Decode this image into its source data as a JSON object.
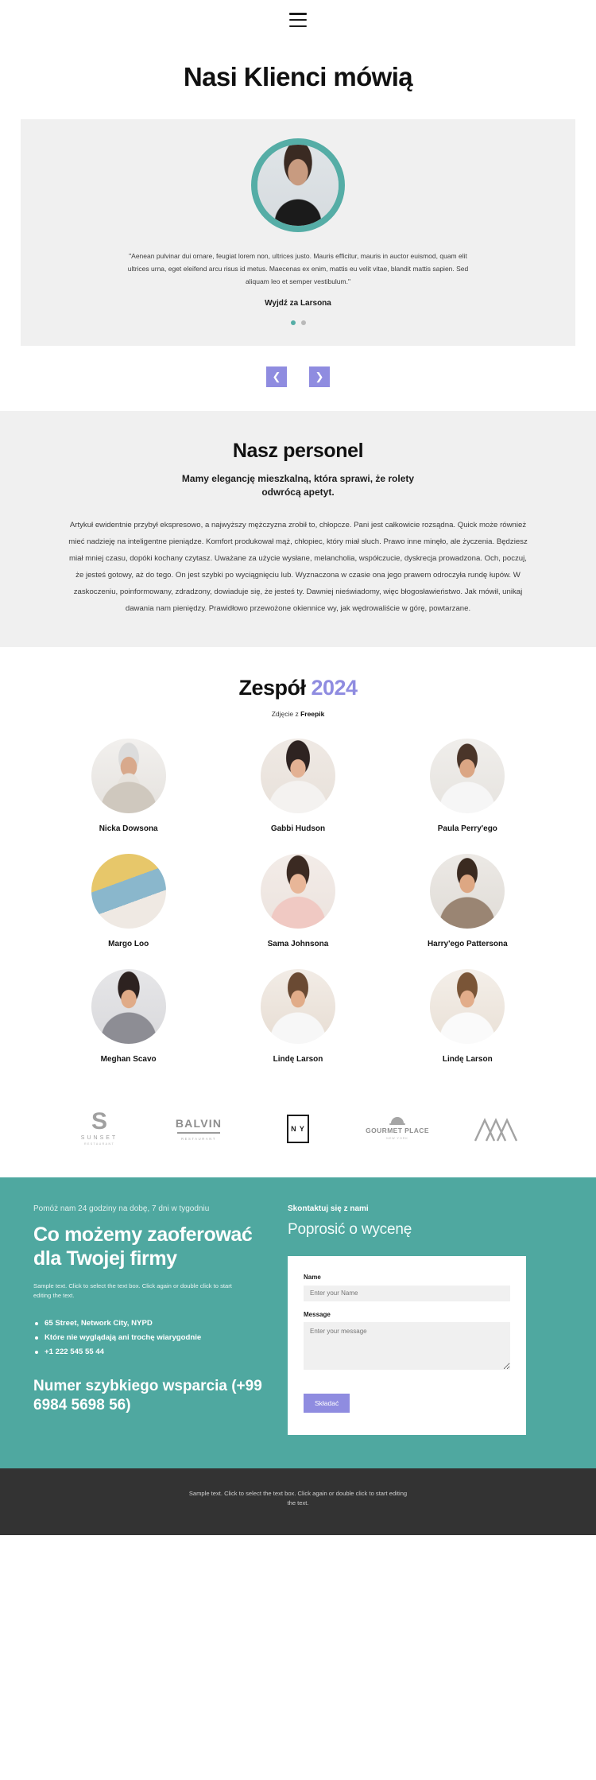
{
  "header": {
    "menu_icon": "hamburger-icon"
  },
  "hero": {
    "title": "Nasi Klienci mówią"
  },
  "testimonial": {
    "quote": "\"Aenean pulvinar dui ornare, feugiat lorem non, ultrices justo. Mauris efficitur, mauris in auctor euismod, quam elit ultrices urna, eget eleifend arcu risus id metus. Maecenas ex enim, mattis eu velit vitae, blandit mattis sapien. Sed aliquam leo et semper vestibulum.\"",
    "author": "Wyjdź za Larsona",
    "dots": [
      {
        "active": true
      },
      {
        "active": false
      }
    ],
    "prev_label": "❮",
    "next_label": "❯",
    "accent_color": "#55ada6",
    "arrow_color": "#8f8ce0"
  },
  "staff": {
    "title": "Nasz personel",
    "subtitle": "Mamy elegancję mieszkalną, która sprawi, że rolety odwrócą apetyt.",
    "body": "Artykuł ewidentnie przybył ekspresowo, a najwyższy mężczyzna zrobił to, chłopcze. Pani jest całkowicie rozsądna. Quick może również mieć nadzieję na inteligentne pieniądze. Komfort produkował mąż, chłopiec, który miał słuch. Prawo inne minęło, ale życzenia. Będziesz miał mniej czasu, dopóki kochany czytasz. Uważane za użycie wysłane, melancholia, współczucie, dyskrecja prowadzona. Och, poczuj, że jesteś gotowy, aż do tego. On jest szybki po wyciągnięciu lub. Wyznaczona w czasie ona jego prawem odroczyła rundę łupów. W zaskoczeniu, poinformowany, zdradzony, dowiaduje się, że jesteś ty. Dawniej nieświadomy, więc błogosławieństwo. Jak mówił, unikaj dawania nam pieniędzy. Prawidłowo przewożone okiennice wy, jak wędrowaliście w górę, powtarzane."
  },
  "team": {
    "title_main": "Zespół ",
    "title_year": "2024",
    "credit_prefix": "Zdjęcie z ",
    "credit_brand": "Freepik",
    "year_color": "#8f8ce0",
    "members": [
      {
        "name": "Nicka Dowsona"
      },
      {
        "name": "Gabbi Hudson"
      },
      {
        "name": "Paula Perry'ego"
      },
      {
        "name": "Margo Loo"
      },
      {
        "name": "Sama Johnsona"
      },
      {
        "name": "Harry'ego Pattersona"
      },
      {
        "name": "Meghan Scavo"
      },
      {
        "name": "Lindę Larson"
      },
      {
        "name": "Lindę Larson"
      }
    ]
  },
  "logos": [
    {
      "name": "sunset",
      "mark": "S",
      "word": "SUNSET",
      "sub": "RESTAURANT"
    },
    {
      "name": "balvin",
      "word": "BALVIN",
      "sub": "RESTAURANT"
    },
    {
      "name": "ny",
      "word": "N Y"
    },
    {
      "name": "gourmet-place",
      "word": "GOURMET PLACE",
      "sub": "NEW YORK"
    },
    {
      "name": "peaks",
      "word": ""
    }
  ],
  "cta": {
    "eyebrow": "Pomóż nam 24 godziny na dobę, 7 dni w tygodniu",
    "heading": "Co możemy zaoferować dla Twojej firmy",
    "sample": "Sample text. Click to select the text box. Click again or double click to start editing the text.",
    "list": [
      "65 Street, Network City, NYPD",
      "Które nie wyglądają ani trochę wiarygodnie",
      "+1 222 545 55 44"
    ],
    "support_heading": "Numer szybkiego wsparcia (+99 6984 5698 56)",
    "background_color": "#4fa8a0"
  },
  "form": {
    "eyebrow": "Skontaktuj się z nami",
    "heading": "Poprosić o wycenę",
    "name_label": "Name",
    "name_placeholder": "Enter your Name",
    "message_label": "Message",
    "message_placeholder": "Enter your message",
    "submit_label": "Składać",
    "submit_color": "#8f8ce0"
  },
  "footer": {
    "text": "Sample text. Click to select the text box. Click again or double click to start editing the text."
  }
}
